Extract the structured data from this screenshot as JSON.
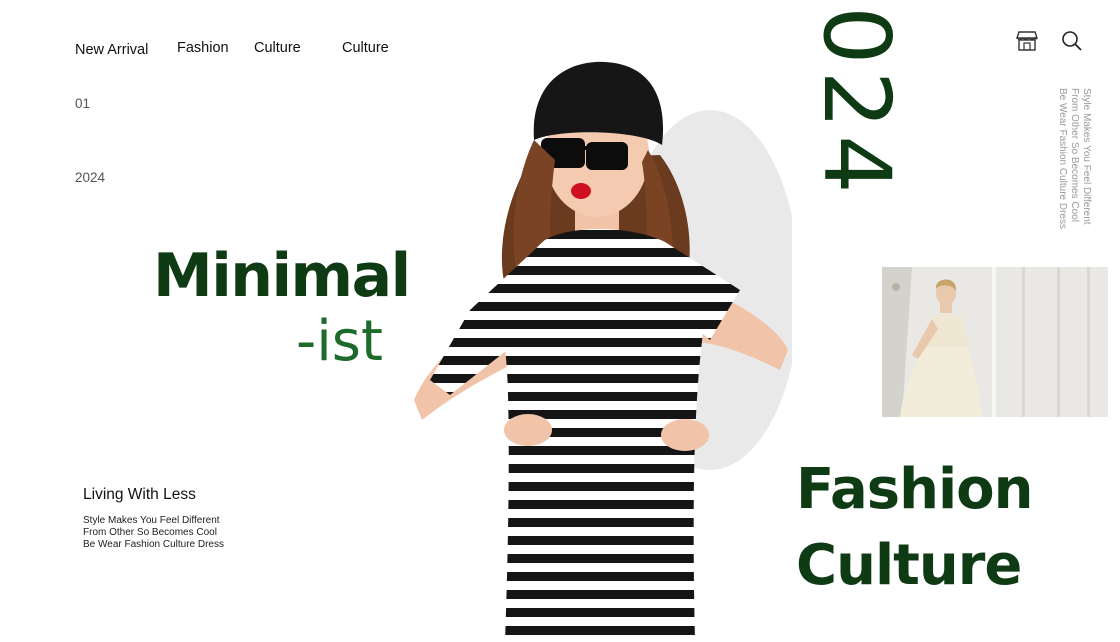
{
  "nav": {
    "items": [
      {
        "label": "New Arrival"
      },
      {
        "label": "Fashion"
      },
      {
        "label": "Culture"
      },
      {
        "label": "Culture"
      }
    ]
  },
  "meta": {
    "number": "01",
    "year": "2024"
  },
  "headline": {
    "line1": "Minimal",
    "line2": "-ist"
  },
  "living": {
    "title": "Living With Less",
    "lines": [
      "Style Makes You Feel Different",
      "From Other So Becomes Cool",
      "Be Wear Fashion Culture Dress"
    ]
  },
  "vertical_year": "024",
  "icons": {
    "store": "store-icon",
    "search": "search-icon"
  },
  "side_text": {
    "lines": [
      "Style Makes You Feel Different",
      "From Other So Becomes Cool",
      "Be Wear Fashion Culture Dress"
    ]
  },
  "feature": {
    "line1": "Fashion",
    "line2": "Culture"
  },
  "colors": {
    "brand_dark_green": "#0f3b14",
    "brand_green": "#1e6a2a"
  }
}
